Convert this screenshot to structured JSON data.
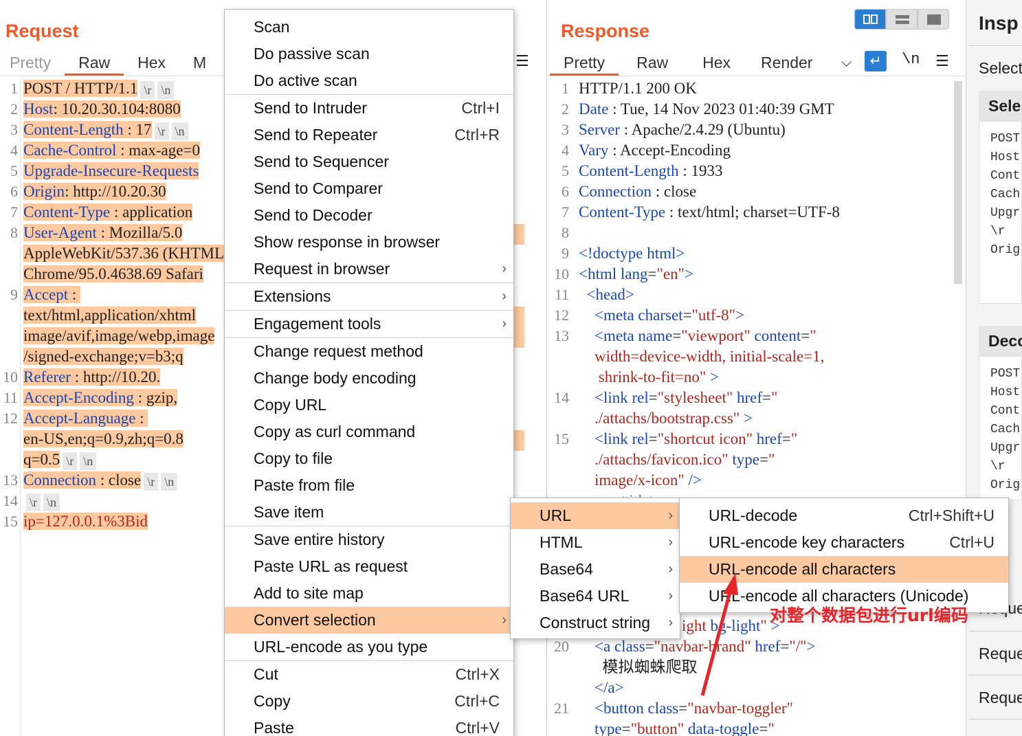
{
  "request": {
    "title": "Request",
    "tabs": [
      "Pretty",
      "Raw",
      "Hex",
      "M"
    ],
    "lines": [
      {
        "n": "1",
        "parts": [
          [
            "hl",
            "POST / HTTP/1.1"
          ]
        ],
        "esc": [
          "\\r",
          "\\n"
        ]
      },
      {
        "n": "2",
        "parts": [
          [
            "hlk",
            "Host"
          ],
          [
            "hl",
            ": 10.20.30.104:8080"
          ]
        ]
      },
      {
        "n": "3",
        "parts": [
          [
            "hlk",
            "Content-Length"
          ],
          [
            "hl",
            " : 17"
          ]
        ],
        "esc": [
          "\\r",
          "\\n"
        ]
      },
      {
        "n": "4",
        "parts": [
          [
            "hlk",
            "Cache-Control"
          ],
          [
            "hl",
            " : max-age=0"
          ]
        ]
      },
      {
        "n": "5",
        "parts": [
          [
            "hlk",
            "Upgrade-Insecure-Requests"
          ]
        ]
      },
      {
        "n": "6",
        "parts": [
          [
            "hlk",
            "Origin"
          ],
          [
            "hl",
            ": http://10.20.30"
          ]
        ]
      },
      {
        "n": "7",
        "parts": [
          [
            "hlk",
            "Content-Type"
          ],
          [
            "hl",
            " : application"
          ]
        ]
      },
      {
        "n": "8",
        "parts": [
          [
            "hlk",
            "User-Agent"
          ],
          [
            "hl",
            " : Mozilla/5.0"
          ]
        ]
      },
      {
        "n": "",
        "parts": [
          [
            "hl",
            "AppleWebKit/537.36 (KHTML"
          ]
        ]
      },
      {
        "n": "",
        "parts": [
          [
            "hl",
            "Chrome/95.0.4638.69 Safari"
          ]
        ]
      },
      {
        "n": "9",
        "parts": [
          [
            "hlk",
            "Accept"
          ],
          [
            "hl",
            " : "
          ]
        ]
      },
      {
        "n": "",
        "parts": [
          [
            "hl",
            "text/html,application/xhtml"
          ]
        ]
      },
      {
        "n": "",
        "parts": [
          [
            "hl",
            "image/avif,image/webp,image"
          ]
        ]
      },
      {
        "n": "",
        "parts": [
          [
            "hl",
            "/signed-exchange;v=b3;q"
          ]
        ]
      },
      {
        "n": "10",
        "parts": [
          [
            "hlk",
            "Referer"
          ],
          [
            "hl",
            " : http://10.20."
          ]
        ]
      },
      {
        "n": "11",
        "parts": [
          [
            "hlk",
            "Accept-Encoding"
          ],
          [
            "hl",
            " : gzip,"
          ]
        ]
      },
      {
        "n": "12",
        "parts": [
          [
            "hlk",
            "Accept-Language"
          ],
          [
            "hl",
            " : "
          ]
        ]
      },
      {
        "n": "",
        "parts": [
          [
            "hl",
            "en-US,en;q=0.9,zh;q=0.8"
          ]
        ]
      },
      {
        "n": "",
        "parts": [
          [
            "hl",
            "q=0.5"
          ]
        ],
        "esc": [
          "\\r",
          "\\n"
        ]
      },
      {
        "n": "13",
        "parts": [
          [
            "hlk",
            "Connection"
          ],
          [
            "hl",
            " : close"
          ]
        ],
        "esc": [
          "\\r",
          "\\n"
        ]
      },
      {
        "n": "14",
        "parts": [],
        "esc": [
          "\\r",
          "\\n"
        ]
      },
      {
        "n": "15",
        "parts": [
          [
            "hls",
            "ip=127.0.0.1%3Bid"
          ]
        ]
      }
    ]
  },
  "response": {
    "title": "Response",
    "tabs": [
      "Pretty",
      "Raw",
      "Hex",
      "Render"
    ],
    "newline_label": "\\n",
    "lines": [
      {
        "n": "1",
        "parts": [
          [
            "t",
            "HTTP/1.1 200 OK"
          ]
        ]
      },
      {
        "n": "2",
        "parts": [
          [
            "k",
            "Date"
          ],
          [
            "t",
            " : Tue, 14 Nov 2023 01:40:39 GMT"
          ]
        ]
      },
      {
        "n": "3",
        "parts": [
          [
            "k",
            "Server"
          ],
          [
            "t",
            " : Apache/2.4.29 (Ubuntu)"
          ]
        ]
      },
      {
        "n": "4",
        "parts": [
          [
            "k",
            "Vary"
          ],
          [
            "t",
            " : Accept-Encoding"
          ]
        ]
      },
      {
        "n": "5",
        "parts": [
          [
            "k",
            "Content-Length"
          ],
          [
            "t",
            " : 1933"
          ]
        ]
      },
      {
        "n": "6",
        "parts": [
          [
            "k",
            "Connection"
          ],
          [
            "t",
            " : close"
          ]
        ]
      },
      {
        "n": "7",
        "parts": [
          [
            "k",
            "Content-Type"
          ],
          [
            "t",
            " : text/html; charset=UTF-8"
          ]
        ]
      },
      {
        "n": "8",
        "parts": []
      },
      {
        "n": "9",
        "parts": [
          [
            "k",
            "<!doctype html>"
          ]
        ]
      },
      {
        "n": "10",
        "parts": [
          [
            "k",
            "<html "
          ],
          [
            "k",
            "lang"
          ],
          [
            "t",
            "="
          ],
          [
            "s",
            "\"en\""
          ],
          [
            "k",
            ">"
          ]
        ]
      },
      {
        "n": "11",
        "parts": [
          [
            "k",
            "  <head>"
          ]
        ]
      },
      {
        "n": "12",
        "parts": [
          [
            "k",
            "    <meta "
          ],
          [
            "k",
            "charset"
          ],
          [
            "t",
            "="
          ],
          [
            "s",
            "\"utf-8\""
          ],
          [
            "k",
            ">"
          ]
        ]
      },
      {
        "n": "13",
        "parts": [
          [
            "k",
            "    <meta "
          ],
          [
            "k",
            "name"
          ],
          [
            "t",
            "="
          ],
          [
            "s",
            "\"viewport\""
          ],
          [
            "k",
            " content"
          ],
          [
            "t",
            "="
          ],
          [
            "s",
            "\""
          ]
        ]
      },
      {
        "n": "",
        "parts": [
          [
            "s",
            "    width=device-width, initial-scale=1,"
          ]
        ]
      },
      {
        "n": "",
        "parts": [
          [
            "s",
            "     shrink-to-fit=no\""
          ],
          [
            "k",
            " >"
          ]
        ]
      },
      {
        "n": "14",
        "parts": [
          [
            "k",
            "    <link "
          ],
          [
            "k",
            "rel"
          ],
          [
            "t",
            "="
          ],
          [
            "s",
            "\"stylesheet\""
          ],
          [
            "k",
            " href"
          ],
          [
            "t",
            "="
          ],
          [
            "s",
            "\""
          ]
        ]
      },
      {
        "n": "",
        "parts": [
          [
            "s",
            "    ./attachs/bootstrap.css\""
          ],
          [
            "k",
            " >"
          ]
        ]
      },
      {
        "n": "15",
        "parts": [
          [
            "k",
            "    <link "
          ],
          [
            "k",
            "rel"
          ],
          [
            "t",
            "="
          ],
          [
            "s",
            "\"shortcut icon\""
          ],
          [
            "k",
            " href"
          ],
          [
            "t",
            "="
          ],
          [
            "s",
            "\""
          ]
        ]
      },
      {
        "n": "",
        "parts": [
          [
            "s",
            "    ./attachs/favicon.ico\""
          ],
          [
            "k",
            " type"
          ],
          [
            "t",
            "="
          ],
          [
            "s",
            "\""
          ]
        ]
      },
      {
        "n": "",
        "parts": [
          [
            "s",
            "    image/x-icon\""
          ],
          [
            "k",
            " />"
          ]
        ]
      }
    ],
    "lower_lines": [
      {
        "n": "",
        "parts": [
          [
            "s",
            "ight"
          ],
          [
            "k",
            " bg-light"
          ],
          [
            "s",
            "\""
          ],
          [
            "k",
            " >"
          ]
        ]
      },
      {
        "n": "20",
        "parts": [
          [
            "k",
            "    <a "
          ],
          [
            "k",
            "class"
          ],
          [
            "t",
            "="
          ],
          [
            "s",
            "\"navbar-brand\""
          ],
          [
            "k",
            " href"
          ],
          [
            "t",
            "="
          ],
          [
            "s",
            "\"/\""
          ],
          [
            "k",
            ">"
          ]
        ]
      },
      {
        "n": "",
        "parts": [
          [
            "t",
            "      模拟蜘蛛爬取"
          ]
        ]
      },
      {
        "n": "",
        "parts": [
          [
            "k",
            "    </a>"
          ]
        ]
      },
      {
        "n": "21",
        "parts": [
          [
            "k",
            "    <button "
          ],
          [
            "k",
            "class"
          ],
          [
            "t",
            "="
          ],
          [
            "s",
            "\"navbar-toggler\""
          ]
        ]
      },
      {
        "n": "",
        "parts": [
          [
            "k",
            "    type"
          ],
          [
            "t",
            "="
          ],
          [
            "s",
            "\"button\""
          ],
          [
            "k",
            " data-toggle"
          ],
          [
            "t",
            "="
          ],
          [
            "s",
            "\""
          ]
        ]
      }
    ]
  },
  "inspector": {
    "title": "Insp",
    "select_label": "Select",
    "sel_header": "Sele",
    "sel_lines": [
      "POST",
      "Host",
      "Cont",
      "Cach",
      "Upgr",
      "\\r",
      "Orig"
    ],
    "dec_header": "Deco",
    "dec_lines": [
      "POST",
      "Host",
      "Cont",
      "Cach",
      "Upgr",
      "\\r",
      "Orig"
    ],
    "req_items": [
      "Reque",
      "Reque",
      "Reque"
    ]
  },
  "context_menu": {
    "groups": [
      [
        {
          "label": "Scan"
        },
        {
          "label": "Do passive scan"
        },
        {
          "label": "Do active scan"
        }
      ],
      [
        {
          "label": "Send to Intruder",
          "shortcut": "Ctrl+I"
        },
        {
          "label": "Send to Repeater",
          "shortcut": "Ctrl+R"
        },
        {
          "label": "Send to Sequencer"
        },
        {
          "label": "Send to Comparer"
        },
        {
          "label": "Send to Decoder"
        },
        {
          "label": "Show response in browser"
        },
        {
          "label": "Request in browser",
          "submenu": true
        }
      ],
      [
        {
          "label": "Extensions",
          "submenu": true
        }
      ],
      [
        {
          "label": "Engagement tools",
          "submenu": true
        }
      ],
      [
        {
          "label": "Change request method"
        },
        {
          "label": "Change body encoding"
        },
        {
          "label": "Copy URL"
        },
        {
          "label": "Copy as curl command"
        },
        {
          "label": "Copy to file"
        },
        {
          "label": "Paste from file"
        },
        {
          "label": "Save item"
        }
      ],
      [
        {
          "label": "Save entire history"
        },
        {
          "label": "Paste URL as request"
        },
        {
          "label": "Add to site map"
        },
        {
          "label": "Convert selection",
          "submenu": true,
          "selected": true
        },
        {
          "label": "URL-encode as you type"
        }
      ],
      [
        {
          "label": "Cut",
          "shortcut": "Ctrl+X"
        },
        {
          "label": "Copy",
          "shortcut": "Ctrl+C"
        },
        {
          "label": "Paste",
          "shortcut": "Ctrl+V"
        }
      ]
    ]
  },
  "convert_menu": [
    {
      "label": "URL",
      "submenu": true,
      "selected": true
    },
    {
      "label": "HTML",
      "submenu": true
    },
    {
      "label": "Base64",
      "submenu": true
    },
    {
      "label": "Base64 URL",
      "submenu": true
    },
    {
      "label": "Construct string",
      "submenu": true
    }
  ],
  "url_menu": [
    {
      "label": "URL-decode",
      "shortcut": "Ctrl+Shift+U"
    },
    {
      "label": "URL-encode key characters",
      "shortcut": "Ctrl+U"
    },
    {
      "label": "URL-encode all characters",
      "selected": true
    },
    {
      "label": "URL-encode all characters (Unicode)"
    }
  ],
  "annotation": "对整个数据包进行url编码",
  "colors": {
    "accent": "#f05a28",
    "highlight": "#fcc9a0",
    "keyword": "#1a47b8",
    "string": "#b3261e",
    "annotation": "#e8242a"
  }
}
